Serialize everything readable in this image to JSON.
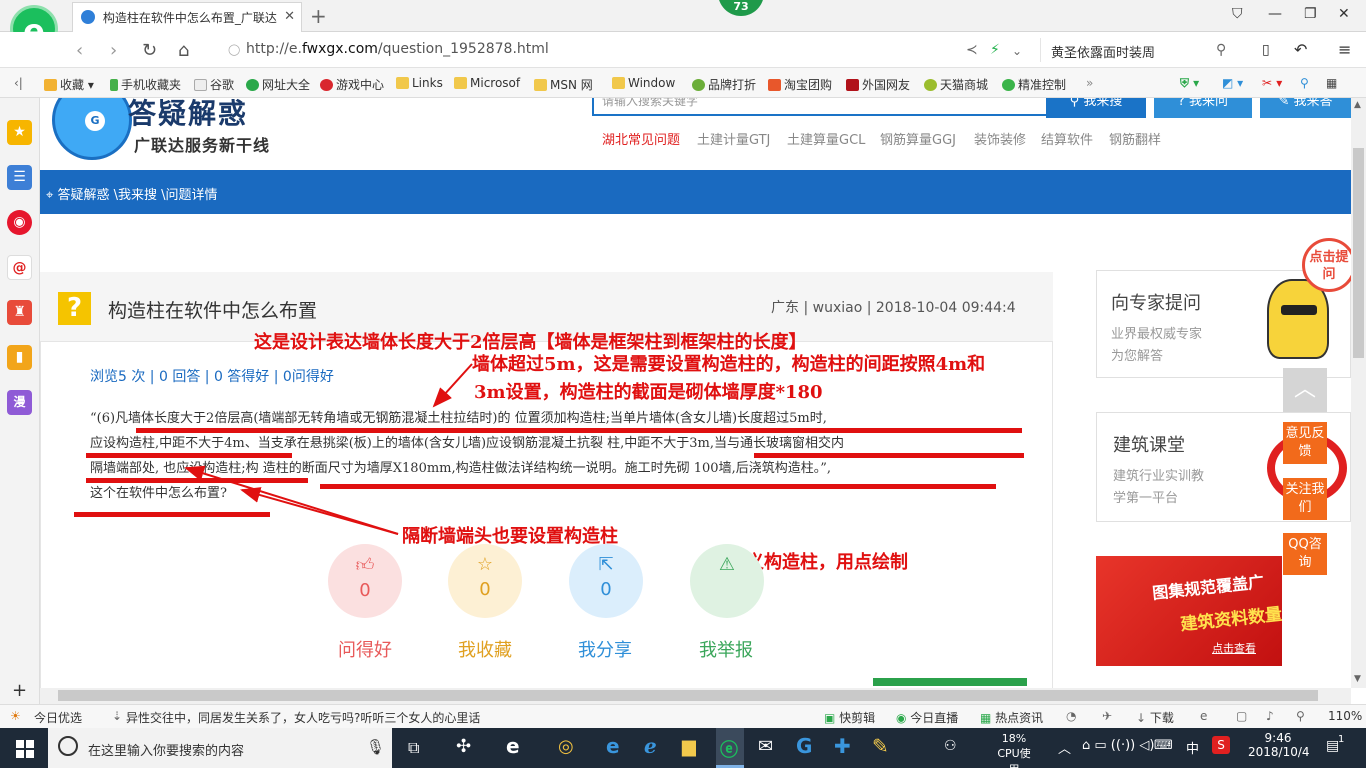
{
  "browser": {
    "tab_title": "构造柱在软件中怎么布置_广联达",
    "badge": "73",
    "url_prefix": "http://e.",
    "url_domain": "fwxgx.com",
    "url_path": "/question_1952878.html",
    "search_text": "黄圣依露面时装周",
    "bookmarks": [
      "收藏",
      "手机收藏夹",
      "谷歌",
      "网址大全",
      "游戏中心",
      "Links",
      "Microsof",
      "MSN 网",
      "Window",
      "品牌打折",
      "淘宝团购",
      "外国网友",
      "天猫商城",
      "精准控制"
    ]
  },
  "site": {
    "logo_text": "答疑解惑",
    "slogan": "广联达服务新干线",
    "search_placeholder": "请输入搜索关键字",
    "btn_search": "我来搜",
    "btn_ask": "我来问",
    "btn_answer": "我来答",
    "nav_links": [
      "湖北常见问题",
      "土建计量GTJ",
      "土建算量GCL",
      "钢筋算量GGJ",
      "装饰装修",
      "结算软件",
      "钢筋翻样"
    ],
    "breadcrumb": "答疑解惑 \\我来搜 \\问题详情"
  },
  "question": {
    "title": "构造柱在软件中怎么布置",
    "meta": "广东 | wuxiao | 2018-10-04 09:44:4",
    "stats": "浏览5 次 | 0 回答 | 0 答得好 | 0问得好",
    "body_lines": [
      "“(6)凡墙体长度大于2倍层高(墙端部无转角墙或无钢筋混凝土柱拉结时)的 位置须加构造柱;当单片墙体(含女儿墙)长度超过5m时,",
      "应设构造柱,中距不大于4m、当支承在悬挑梁(板)上的墙体(含女儿墙)应设钢筋混凝土抗裂 柱,中距不大于3m,当与通长玻璃窗相交内",
      "隔墙端部处, 也应设构造柱;构 造柱的断面尺寸为墙厚X180mm,构造柱做法详结构统一说明。施工时先砌 100墙,后浇筑构造柱。”,",
      "这个在软件中怎么布置?"
    ],
    "actions": [
      {
        "label": "问得好",
        "count": "0",
        "color": "#e85a5a"
      },
      {
        "label": "我收藏",
        "count": "0",
        "color": "#e0a020"
      },
      {
        "label": "我分享",
        "count": "0",
        "color": "#2f8fd8"
      },
      {
        "label": "我举报",
        "count": "0",
        "color": "#3aa65a"
      }
    ]
  },
  "annotations": {
    "a1": "这是设计表达墙体长度大于2倍层高【墙体是框架柱到框架柱的长度】",
    "a2_line1": "墙体超过5m，这是需要设置构造柱的，构造柱的间距按照4m和",
    "a2_line2": "3m设置，构造柱的截面是砌体墙厚度*180",
    "a3": "隔断墙端头也要设置构造柱",
    "a4": "定义构造柱，用点绘制"
  },
  "sidebar": {
    "expert_title": "向专家提问",
    "expert_sub1": "业界最权威专家",
    "expert_sub2": "为您解答",
    "course_title": "建筑课堂",
    "course_sub1": "建筑行业实训教",
    "course_sub2": "学第一平台",
    "feedback": "意见反馈",
    "follow": "关注我们",
    "qq": "QQ咨询",
    "ad_line1": "图集规范覆盖广",
    "ad_line2": "建筑资料数量多",
    "ad_btn": "点击查看",
    "bubble": "点击提问"
  },
  "statusbar": {
    "left": "今日优选",
    "news": "异性交往中，同居发生关系了，女人吃亏吗?听听三个女人的心里话",
    "items": [
      "快剪辑",
      "今日直播",
      "热点资讯",
      "下载"
    ],
    "zoom": "110%"
  },
  "taskbar": {
    "search_placeholder": "在这里输入你要搜索的内容",
    "cpu_percent": "18%",
    "cpu_label": "CPU使用",
    "ime": "中",
    "time": "9:46",
    "date": "2018/10/4",
    "notif": "1"
  }
}
